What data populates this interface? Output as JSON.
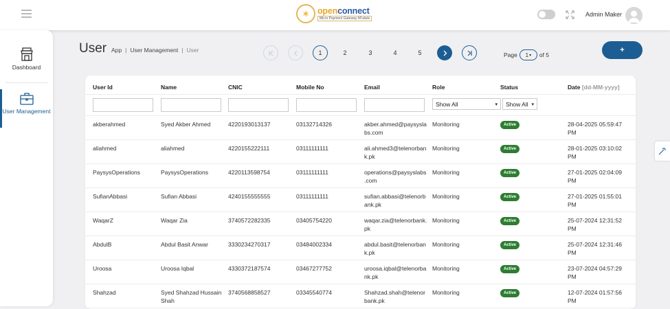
{
  "header": {
    "brand_name_left": "open",
    "brand_name_right": "connect",
    "brand_subtitle": "Micro Payment Gateway M'odule",
    "admin_name": "Admin Maker"
  },
  "sidebar": {
    "items": [
      {
        "label": "Dashboard",
        "icon": "store-icon"
      },
      {
        "label": "User Management",
        "icon": "briefcase-icon",
        "active": true
      }
    ]
  },
  "page": {
    "title": "User",
    "breadcrumb": [
      "App",
      "User Management",
      "User"
    ]
  },
  "pagination": {
    "pages": [
      "1",
      "2",
      "3",
      "4",
      "5"
    ],
    "current": "1",
    "page_label": "Page",
    "of_label": "of 5"
  },
  "add_button": "+",
  "table": {
    "columns": [
      "User Id",
      "Name",
      "CNIC",
      "Mobile No",
      "Email",
      "Role",
      "Status",
      "Date"
    ],
    "date_format_hint": "[dd-MM-yyyy]",
    "role_filter": "Show All",
    "status_filter": "Show All",
    "rows": [
      {
        "user_id": "akberahmed",
        "name": "Syed Akber Ahmed",
        "cnic": "4220193013137",
        "mobile": "03132714326",
        "email": [
          "akber.ahmed@paysysla",
          "bs.com"
        ],
        "role": "Monitoring",
        "status": "Active",
        "date": [
          "28-04-2025 05:59:47",
          "PM"
        ]
      },
      {
        "user_id": "aliahmed",
        "name": "aliahmed",
        "cnic": "4220155222111",
        "mobile": "03111111111",
        "email": [
          "ali.ahmed3@telenorban",
          "k.pk"
        ],
        "role": "Monitoring",
        "status": "Active",
        "date": [
          "28-01-2025 03:10:02",
          "PM"
        ]
      },
      {
        "user_id": "PaysysOperations",
        "name": "PaysysOperations",
        "cnic": "4220113598754",
        "mobile": "03111111111",
        "email": [
          "operations@paysyslabs",
          ".com"
        ],
        "role": "Monitoring",
        "status": "Active",
        "date": [
          "27-01-2025 02:04:09",
          "PM"
        ]
      },
      {
        "user_id": "SufianAbbasi",
        "name": "Sufian Abbasi",
        "cnic": "4240155555555",
        "mobile": "03111111111",
        "email": [
          "sufian.abbasi@telenorb",
          "ank.pk"
        ],
        "role": "Monitoring",
        "status": "Active",
        "date": [
          "27-01-2025 01:55:01",
          "PM"
        ]
      },
      {
        "user_id": "WaqarZ",
        "name": "Waqar Zia",
        "cnic": "3740572282335",
        "mobile": "03405754220",
        "email": [
          "waqar.zia@telenorbank.",
          "pk"
        ],
        "role": "Monitoring",
        "status": "Active",
        "date": [
          "25-07-2024 12:31:52",
          "PM"
        ]
      },
      {
        "user_id": "AbdulB",
        "name": "Abdul Basit Anwar",
        "cnic": "3330234270317",
        "mobile": "03484002334",
        "email": [
          "abdul.basit@telenorban",
          "k.pk"
        ],
        "role": "Monitoring",
        "status": "Active",
        "date": [
          "25-07-2024 12:31:46",
          "PM"
        ]
      },
      {
        "user_id": "Uroosa",
        "name": "Uroosa Iqbal",
        "cnic": "4330372187574",
        "mobile": "03467277752",
        "email": [
          "uroosa.iqbal@telenorba",
          "nk.pk"
        ],
        "role": "Monitoring",
        "status": "Active",
        "date": [
          "23-07-2024 04:57:29",
          "PM"
        ]
      },
      {
        "user_id": "Shahzad",
        "name": [
          "Syed Shahzad Hussain",
          "Shah"
        ],
        "cnic": "3740568858527",
        "mobile": "03345540774",
        "email": [
          "Shahzad.shah@telenor",
          "bank.pk"
        ],
        "role": "Monitoring",
        "status": "Active",
        "date": [
          "12-07-2024 01:57:56",
          "PM"
        ]
      }
    ]
  },
  "colors": {
    "primary": "#1c5d93",
    "active_badge": "#2e7d32",
    "brand_orange": "#e7a62a",
    "brand_blue": "#2b5aa5"
  }
}
